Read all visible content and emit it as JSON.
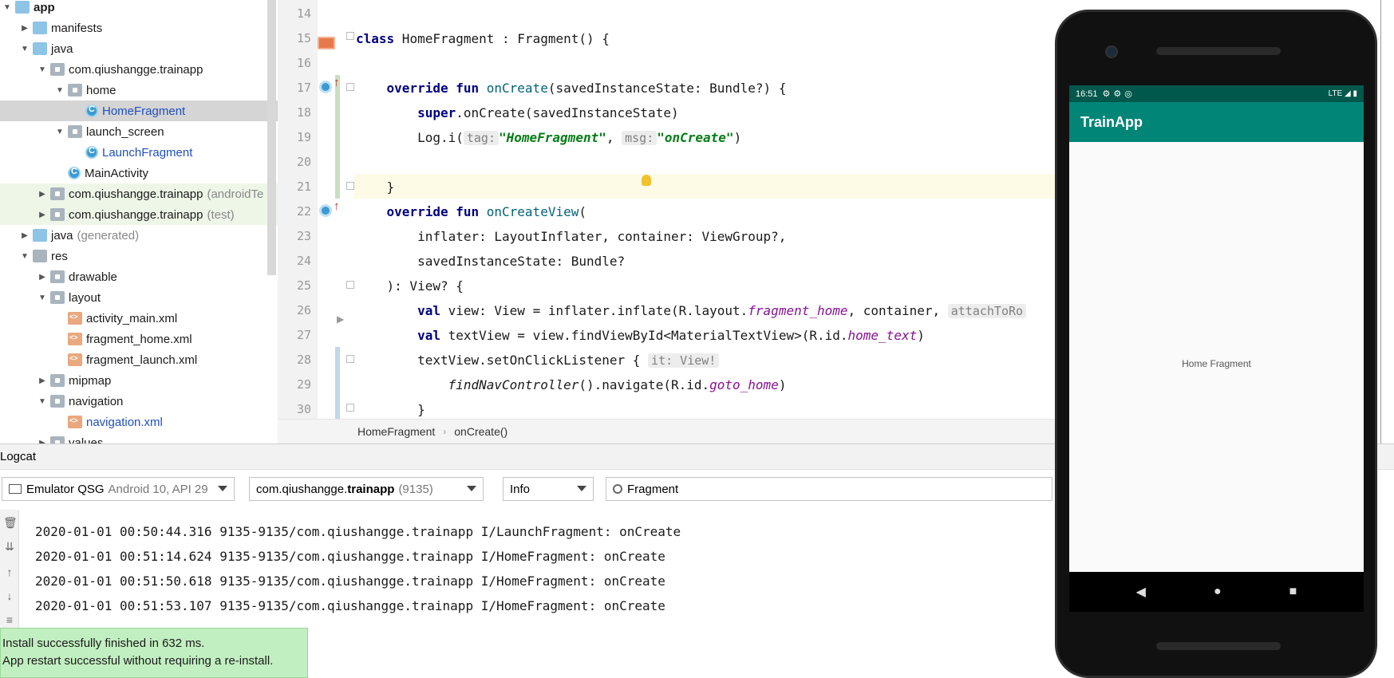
{
  "project_tree": {
    "items": [
      {
        "label": "app",
        "depth": 0,
        "arrow": "▼",
        "icon": "folder-icon",
        "bold": true
      },
      {
        "label": "manifests",
        "depth": 1,
        "arrow": "▶",
        "icon": "folder-icon"
      },
      {
        "label": "java",
        "depth": 1,
        "arrow": "▼",
        "icon": "folder-icon"
      },
      {
        "label": "com.qiushangge.trainapp",
        "depth": 2,
        "arrow": "▼",
        "icon": "package-icon"
      },
      {
        "label": "home",
        "depth": 3,
        "arrow": "▼",
        "icon": "package-icon"
      },
      {
        "label": "HomeFragment",
        "depth": 4,
        "arrow": "",
        "icon": "kotlin-class-icon",
        "blue": true,
        "selected": true
      },
      {
        "label": "launch_screen",
        "depth": 3,
        "arrow": "▼",
        "icon": "package-icon"
      },
      {
        "label": "LaunchFragment",
        "depth": 4,
        "arrow": "",
        "icon": "kotlin-class-icon",
        "blue": true
      },
      {
        "label": "MainActivity",
        "depth": 3,
        "arrow": "",
        "icon": "kotlin-class-icon"
      },
      {
        "label": "com.qiushangge.trainapp",
        "suffix": "(androidTe",
        "depth": 2,
        "arrow": "▶",
        "icon": "package-icon",
        "tinted": true
      },
      {
        "label": "com.qiushangge.trainapp",
        "suffix": "(test)",
        "depth": 2,
        "arrow": "▶",
        "icon": "package-icon",
        "tinted": true
      },
      {
        "label": "java",
        "suffix": "(generated)",
        "depth": 1,
        "arrow": "▶",
        "icon": "folder-icon"
      },
      {
        "label": "res",
        "depth": 1,
        "arrow": "▼",
        "icon": "res-folder-icon"
      },
      {
        "label": "drawable",
        "depth": 2,
        "arrow": "▶",
        "icon": "package-icon"
      },
      {
        "label": "layout",
        "depth": 2,
        "arrow": "▼",
        "icon": "package-icon"
      },
      {
        "label": "activity_main.xml",
        "depth": 3,
        "arrow": "",
        "icon": "xml-icon"
      },
      {
        "label": "fragment_home.xml",
        "depth": 3,
        "arrow": "",
        "icon": "xml-icon"
      },
      {
        "label": "fragment_launch.xml",
        "depth": 3,
        "arrow": "",
        "icon": "xml-icon"
      },
      {
        "label": "mipmap",
        "depth": 2,
        "arrow": "▶",
        "icon": "package-icon"
      },
      {
        "label": "navigation",
        "depth": 2,
        "arrow": "▼",
        "icon": "package-icon"
      },
      {
        "label": "navigation.xml",
        "depth": 3,
        "arrow": "",
        "icon": "xml-icon",
        "blue": true
      },
      {
        "label": "values",
        "depth": 2,
        "arrow": "▶",
        "icon": "package-icon"
      }
    ]
  },
  "editor": {
    "line_numbers": [
      "14",
      "15",
      "16",
      "17",
      "18",
      "19",
      "20",
      "21",
      "22",
      "23",
      "24",
      "25",
      "26",
      "27",
      "28",
      "29",
      "30"
    ],
    "breadcrumb": [
      "HomeFragment",
      "onCreate()"
    ],
    "code": {
      "l15": {
        "kw": "class",
        "rest": " HomeFragment : Fragment() {"
      },
      "l17": {
        "indent": "    ",
        "kw": "override fun",
        "fn": " onCreate",
        "rest": "(savedInstanceState: Bundle?) {"
      },
      "l18": {
        "indent": "        ",
        "kw": "super",
        "rest": ".onCreate(savedInstanceState)"
      },
      "l19": {
        "indent": "        ",
        "pre": "Log.i(",
        "hint1": "tag:",
        "str1": "\"HomeFragment\"",
        "sep": ", ",
        "hint2": "msg:",
        "str2": "\"onCreate\"",
        "post": ")"
      },
      "l21": {
        "indent": "    ",
        "rest": "}"
      },
      "l22": {
        "indent": "    ",
        "kw": "override fun",
        "fn": " onCreateView",
        "rest": "("
      },
      "l23": {
        "indent": "        ",
        "rest": "inflater: LayoutInflater, container: ViewGroup?,"
      },
      "l24": {
        "indent": "        ",
        "rest": "savedInstanceState: Bundle?"
      },
      "l25": {
        "indent": "    ",
        "rest": "): View? {"
      },
      "l26": {
        "indent": "        ",
        "kw": "val",
        "pre": " view: View = inflater.inflate(R.layout.",
        "res": "fragment_home",
        "post": ", container, ",
        "hint": "attachToRo"
      },
      "l27": {
        "indent": "        ",
        "kw": "val",
        "pre": " textView = view.findViewById<MaterialTextView>(R.id.",
        "res": "home_text",
        "post": ")"
      },
      "l28": {
        "indent": "        ",
        "pre": "textView.setOnClickListener { ",
        "hint": "it: View!"
      },
      "l29": {
        "indent": "            ",
        "italic": "findNavController",
        "pre": "().navigate(R.id.",
        "res": "goto_home",
        "post": ")"
      },
      "l30": {
        "indent": "        ",
        "rest": "}"
      }
    }
  },
  "logcat": {
    "title": "Logcat",
    "device": {
      "name": "Emulator QSG",
      "detail": "Android 10, API 29"
    },
    "process": {
      "name_pre": "com.qiushangge.",
      "name_bold": "trainapp",
      "pid": "(9135)"
    },
    "level": "Info",
    "search": "Fragment",
    "lines": [
      "2020-01-01 00:50:44.316 9135-9135/com.qiushangge.trainapp I/LaunchFragment: onCreate",
      "2020-01-01 00:51:14.624 9135-9135/com.qiushangge.trainapp I/HomeFragment: onCreate",
      "2020-01-01 00:51:50.618 9135-9135/com.qiushangge.trainapp I/HomeFragment: onCreate",
      "2020-01-01 00:51:53.107 9135-9135/com.qiushangge.trainapp I/HomeFragment: onCreate"
    ],
    "side_icons": [
      "trash-icon",
      "scroll-end-icon",
      "up-arrow-icon",
      "down-arrow-icon",
      "menu-icon"
    ]
  },
  "toast": {
    "line1": "Install successfully finished in 632 ms.",
    "line2": "App restart successful without requiring a re-install."
  },
  "phone": {
    "time": "16:51",
    "network": "LTE",
    "app_title": "TrainApp",
    "content_text": "Home Fragment"
  },
  "colors": {
    "status_bar": "#00574b",
    "app_bar": "#008577",
    "toast_bg": "#c2efc1"
  }
}
